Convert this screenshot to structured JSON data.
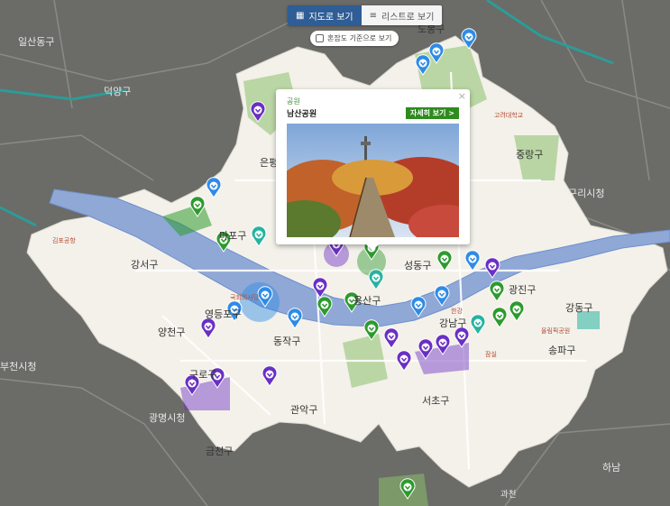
{
  "view_toggle": {
    "map_view": "지도로 보기",
    "list_view": "리스트로 보기",
    "congestion_filter": "혼잡도 기준으로 보기"
  },
  "popup": {
    "category": "공원",
    "title": "남산공원",
    "detail_button": "자세히 보기 >",
    "close": "×"
  },
  "map": {
    "districts": [
      "도봉구",
      "일산동구",
      "덕양구",
      "마포구",
      "강서구",
      "영등포구",
      "양천구",
      "구로구",
      "관악구",
      "동작구",
      "서초구",
      "강남구",
      "송파구",
      "강동구",
      "광진구",
      "중랑구",
      "은평구",
      "용산구",
      "구리시청",
      "광명시청",
      "부천시청",
      "과천",
      "하남",
      "금천구",
      "성동구"
    ],
    "small_labels": [
      "김포공항",
      "한강",
      "국회의사당",
      "올림픽공원",
      "잠실",
      "고려대학교"
    ],
    "colors": {
      "outside": "#6b6b68",
      "seoul": "#f3f1ea",
      "river": "#8fa8d6",
      "green": "#8bbf6a",
      "pin_purple": "#6a2fc4",
      "pin_blue": "#2f8be6",
      "pin_green": "#2e9a2e",
      "pin_teal": "#27b3a0"
    },
    "pin_types": [
      "purple-pin-icon",
      "blue-pin-icon",
      "green-pin-icon",
      "teal-pin-icon"
    ]
  }
}
